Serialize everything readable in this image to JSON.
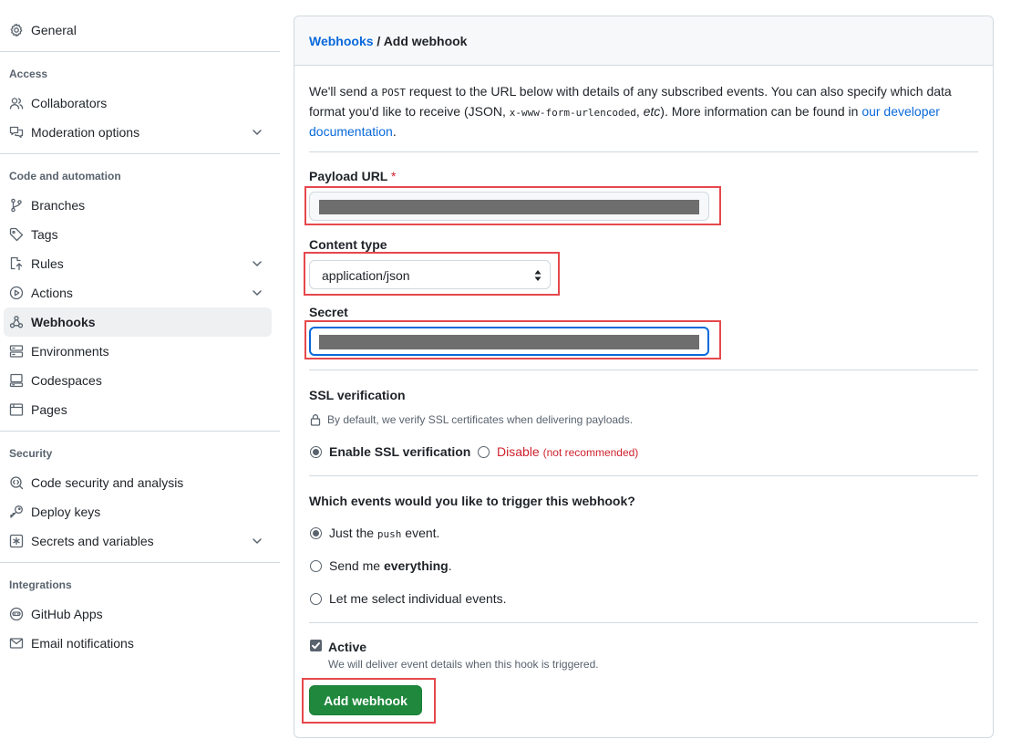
{
  "sidebar": {
    "general": "General",
    "sections": {
      "access": "Access",
      "code_automation": "Code and automation",
      "security": "Security",
      "integrations": "Integrations"
    },
    "items": {
      "collaborators": "Collaborators",
      "moderation": "Moderation options",
      "branches": "Branches",
      "tags": "Tags",
      "rules": "Rules",
      "actions": "Actions",
      "webhooks": "Webhooks",
      "environments": "Environments",
      "codespaces": "Codespaces",
      "pages": "Pages",
      "code_security": "Code security and analysis",
      "deploy_keys": "Deploy keys",
      "secrets": "Secrets and variables",
      "github_apps": "GitHub Apps",
      "email_notifications": "Email notifications"
    },
    "active_item": "webhooks"
  },
  "breadcrumb": {
    "parent": "Webhooks",
    "separator": " / ",
    "current": "Add webhook"
  },
  "intro": {
    "p1": "We'll send a ",
    "code1": "POST",
    "p2": " request to the URL below with details of any subscribed events. You can also specify which data format you'd like to receive (JSON, ",
    "code2": "x-www-form-urlencoded",
    "p3": ", ",
    "etc": "etc",
    "p4": "). More information can be found in ",
    "link": "our developer documentation",
    "p5": "."
  },
  "form": {
    "payload_url_label": "Payload URL",
    "required_mark": "*",
    "content_type_label": "Content type",
    "content_type_value": "application/json",
    "secret_label": "Secret"
  },
  "ssl": {
    "title": "SSL verification",
    "note": "By default, we verify SSL certificates when delivering payloads.",
    "enable": "Enable SSL verification",
    "disable": "Disable",
    "disable_hint": "(not recommended)",
    "selected": "enable"
  },
  "events": {
    "title": "Which events would you like to trigger this webhook?",
    "just_push_a": "Just the ",
    "just_push_code": "push",
    "just_push_b": " event.",
    "everything_a": "Send me ",
    "everything_b": "everything",
    "everything_c": ".",
    "individual": "Let me select individual events.",
    "selected": "just_push"
  },
  "active": {
    "label": "Active",
    "hint": "We will deliver event details when this hook is triggered.",
    "checked": true
  },
  "submit_label": "Add webhook",
  "colors": {
    "link": "#0969da",
    "primary_button": "#1f883d",
    "highlight": "#e5484d",
    "danger": "#cf222e"
  }
}
